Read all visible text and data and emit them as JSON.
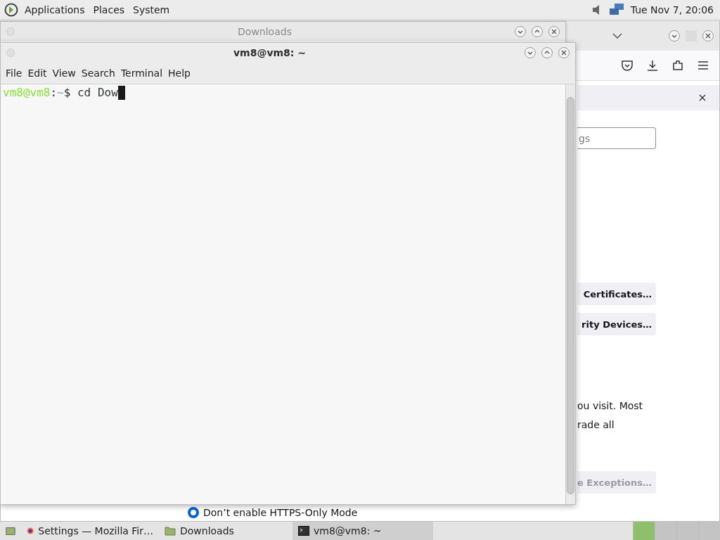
{
  "top_panel": {
    "menus": [
      "Applications",
      "Places",
      "System"
    ],
    "clock": "Tue Nov 7, 20:06"
  },
  "firefox_window": {
    "search": {
      "placeholder": "gs"
    },
    "buttons": [
      {
        "label": "Certificates…",
        "disabled": false
      },
      {
        "label": "rity Devices…",
        "disabled": false
      }
    ],
    "text_lines": [
      "ou visit. Most",
      "rade all"
    ],
    "exceptions_button": {
      "label": "e Exceptions…",
      "disabled": true
    },
    "radio": {
      "label": "Don’t enable HTTPS-Only Mode",
      "selected": true
    }
  },
  "downloads_window": {
    "title": "Downloads"
  },
  "terminal": {
    "title": "vm8@vm8: ~",
    "menus": [
      "File",
      "Edit",
      "View",
      "Search",
      "Terminal",
      "Help"
    ],
    "prompt": {
      "user_host": "vm8@vm8",
      "separator": ":",
      "path": "~",
      "symbol": "$",
      "command": "cd Dow"
    }
  },
  "taskbar": {
    "tasks": [
      {
        "label": "Settings — Mozilla Fir…",
        "kind": "browser",
        "selected": false
      },
      {
        "label": "Downloads",
        "kind": "folder",
        "selected": false
      },
      {
        "label": "vm8@vm8: ~",
        "kind": "terminal",
        "selected": true
      }
    ],
    "workspaces": [
      {
        "selected": true
      },
      {
        "selected": false
      },
      {
        "selected": false
      },
      {
        "selected": false
      }
    ]
  }
}
